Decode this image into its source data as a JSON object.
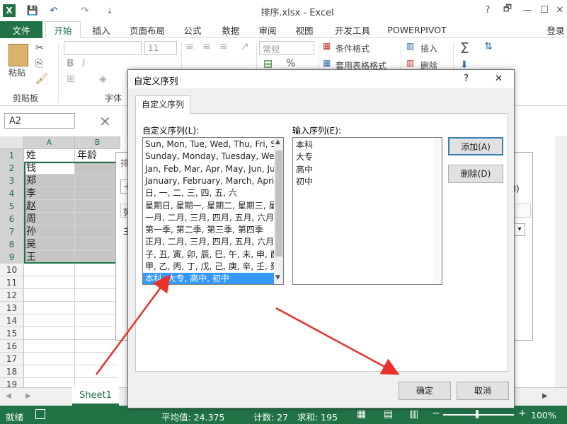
{
  "window": {
    "title": "排序.xlsx - Excel",
    "app_icon": "X",
    "help": "?",
    "restore": "🗗",
    "minimize": "—",
    "maximize": "☐",
    "close": "✕"
  },
  "quick_access": {
    "save": "💾",
    "undo": "↶",
    "redo": "↷",
    "customize": "⇣"
  },
  "ribbon_tabs": [
    "文件",
    "开始",
    "插入",
    "页面布局",
    "公式",
    "数据",
    "审阅",
    "视图",
    "开发工具",
    "POWERPIVOT"
  ],
  "login": "登录",
  "ribbon": {
    "clipboard_group": "剪贴板",
    "paste": "粘贴",
    "font_group": "字体",
    "font_size": "11",
    "number_format": "常规",
    "conditional_format": "条件格式",
    "table_format": "套用表格格式",
    "insert": "插入",
    "delete": "删除",
    "percent": "%"
  },
  "formula_bar": {
    "name_box": "A2"
  },
  "sheet": {
    "columns": [
      "A",
      "B"
    ],
    "rows": [
      "1",
      "2",
      "3",
      "4",
      "5",
      "6",
      "7",
      "8",
      "9",
      "10",
      "11",
      "12",
      "13",
      "14",
      "15",
      "16",
      "17",
      "18",
      "19"
    ],
    "col_a": [
      "姓",
      "钱",
      "郑",
      "李",
      "赵",
      "周",
      "孙",
      "吴",
      "王"
    ],
    "col_b": [
      "年龄",
      "",
      "",
      "",
      "",
      "",
      "",
      "",
      ""
    ]
  },
  "sort_dialog_partial": {
    "title": "排",
    "col_header": "列",
    "row_label": "主",
    "right_letter": "H)"
  },
  "sheet_tabs": [
    "Sheet1"
  ],
  "status_bar": {
    "ready": "就绪",
    "average": "平均值: 24.375",
    "count": "计数: 27",
    "sum": "求和: 195",
    "zoom": "100%"
  },
  "dialog": {
    "title": "自定义序列",
    "help": "?",
    "close": "✕",
    "tab": "自定义序列",
    "lists_label": "自定义序列(L):",
    "entries_label": "输入序列(E):",
    "lists": [
      "Sun, Mon, Tue, Wed, Thu, Fri, S",
      "Sunday, Monday, Tuesday, Wec",
      "Jan, Feb, Mar, Apr, May, Jun, Ju",
      "January, February, March, April,",
      "日, 一, 二, 三, 四, 五, 六",
      "星期日, 星期一, 星期二, 星期三, 星",
      "一月, 二月, 三月, 四月, 五月, 六月,",
      "第一季, 第二季, 第三季, 第四季",
      "正月, 二月, 三月, 四月, 五月, 六月,",
      "子, 丑, 寅, 卯, 辰, 巳, 午, 未, 申, 酉",
      "甲, 乙, 丙, 丁, 戊, 己, 庚, 辛, 壬, 癸",
      "本科, 大专, 高中, 初中"
    ],
    "selected_index": 11,
    "entries": [
      "本科",
      "大专",
      "高中",
      "初中"
    ],
    "add_button": "添加(A)",
    "delete_button": "删除(D)",
    "ok_button": "确定",
    "cancel_button": "取消"
  },
  "colors": {
    "accent": "#217346",
    "selection": "#3399ff",
    "arrow": "#e8322b"
  }
}
